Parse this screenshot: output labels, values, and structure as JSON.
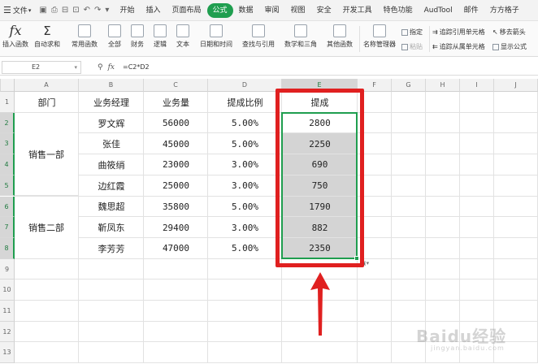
{
  "menu": {
    "file_label": "文件",
    "tabs": [
      "开始",
      "插入",
      "页面布局",
      "公式",
      "数据",
      "审阅",
      "视图",
      "安全",
      "开发工具",
      "特色功能",
      "AudTool",
      "邮件",
      "方方格子"
    ],
    "active_tab": "公式"
  },
  "ribbon": {
    "insert_function": "插入函数",
    "autosum": "自动求和",
    "common_functions": "常用函数",
    "all": "全部",
    "finance": "财务",
    "logic": "逻辑",
    "text": "文本",
    "datetime": "日期和时间",
    "lookup": "查找与引用",
    "math": "数学和三角",
    "other": "其他函数",
    "name_manager": "名称管理器",
    "define": "指定",
    "paste": "粘贴",
    "trace_precedents": "追踪引用单元格",
    "trace_dependents": "追踪从属单元格",
    "remove_arrows": "移去箭头",
    "show_formulas": "显示公式"
  },
  "formula_bar": {
    "cell_ref": "E2",
    "formula": "=C2*D2"
  },
  "sheet": {
    "columns": [
      "A",
      "B",
      "C",
      "D",
      "E",
      "F",
      "G",
      "H",
      "I",
      "J"
    ],
    "selected_column": "E",
    "rows": [
      "1",
      "2",
      "3",
      "4",
      "5",
      "6",
      "7",
      "8",
      "9",
      "10",
      "11",
      "12",
      "13"
    ],
    "headers": {
      "dept": "部门",
      "manager": "业务经理",
      "volume": "业务量",
      "ratio": "提成比例",
      "commission": "提成"
    },
    "groups": [
      {
        "dept": "销售一部"
      },
      {
        "dept": "销售二部"
      }
    ],
    "records": [
      {
        "manager": "罗文辉",
        "volume": "56000",
        "ratio": "5.00%",
        "commission": "2800"
      },
      {
        "manager": "张佳",
        "volume": "45000",
        "ratio": "5.00%",
        "commission": "2250"
      },
      {
        "manager": "曲筱绡",
        "volume": "23000",
        "ratio": "3.00%",
        "commission": "690"
      },
      {
        "manager": "边红霞",
        "volume": "25000",
        "ratio": "3.00%",
        "commission": "750"
      },
      {
        "manager": "魏思超",
        "volume": "35800",
        "ratio": "5.00%",
        "commission": "1790"
      },
      {
        "manager": "靳凤东",
        "volume": "29400",
        "ratio": "3.00%",
        "commission": "882"
      },
      {
        "manager": "李芳芳",
        "volume": "47000",
        "ratio": "5.00%",
        "commission": "2350"
      }
    ]
  },
  "watermark": {
    "brand": "Baidu经验",
    "url": "jingyan.baidu.com"
  },
  "colors": {
    "accent": "#1f9e4f",
    "highlight_box": "#e02020",
    "selection_fill": "#d4d4d4"
  }
}
